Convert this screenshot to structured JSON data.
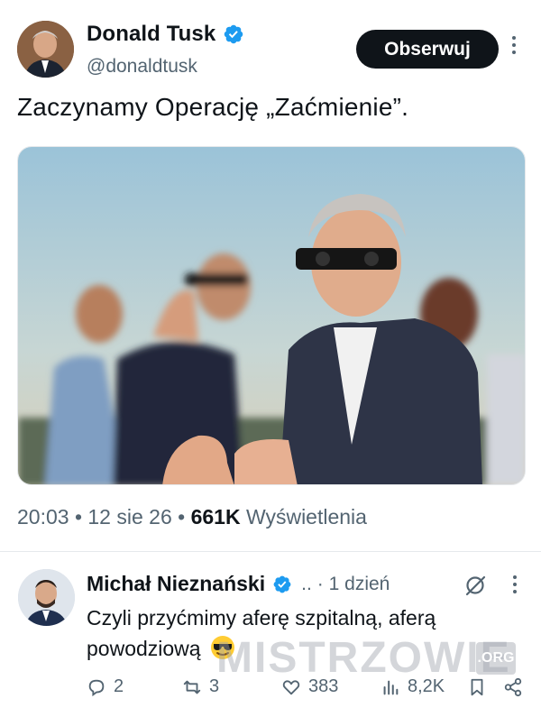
{
  "tweet": {
    "author_name": "Donald Tusk",
    "author_handle": "@donaldtusk",
    "follow_label": "Obserwuj",
    "text": "Zaczynamy Operację „Zaćmienie”.",
    "meta_time": "20:03 • 12 sie 26 • ",
    "views_count": "661K",
    "views_label": " Wyświetlenia"
  },
  "reply": {
    "author_name": "Michał Nieznański",
    "ellipsis": "..",
    "time": "· 1 dzień",
    "text": "Czyli przyćmimy aferę szpitalną, aferą powodziową",
    "replies": "2",
    "reposts": "3",
    "likes": "383",
    "views": "8,2K"
  },
  "watermark": {
    "text": "MISTRZOWIE",
    "tag": ".ORG"
  },
  "colors": {
    "verified": "#1d9bf0",
    "text_primary": "#0f1419",
    "text_secondary": "#536471",
    "button_bg": "#0f1419"
  },
  "icons": {
    "verified": "verified-badge-icon",
    "more": "more-dots-icon",
    "grok": "grok-icon",
    "reply": "reply-icon",
    "repost": "repost-icon",
    "like": "like-icon",
    "views": "views-icon",
    "bookmark": "bookmark-icon",
    "share": "share-icon",
    "emoji": "sunglasses-emoji-icon"
  }
}
